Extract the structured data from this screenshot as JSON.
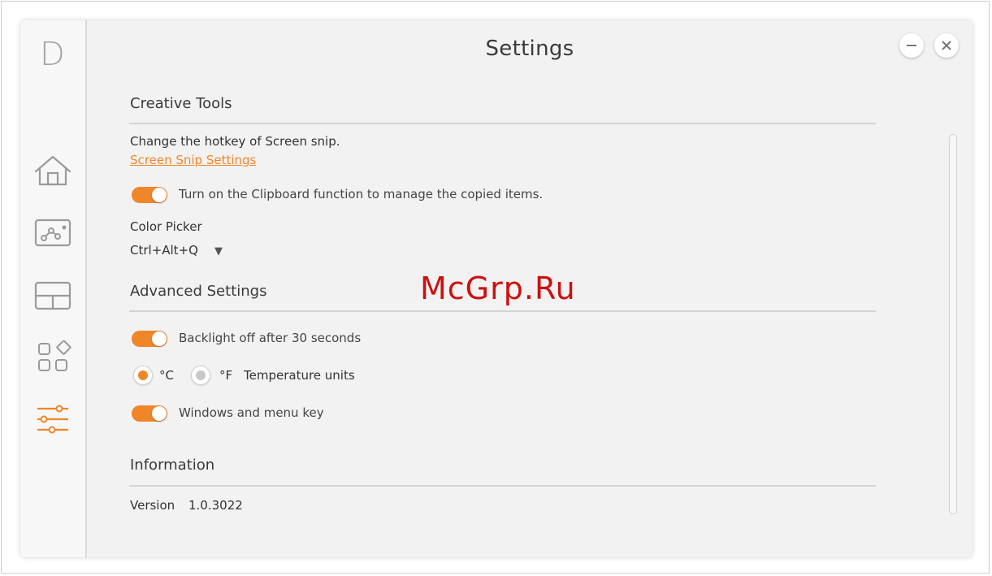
{
  "window": {
    "title": "Settings",
    "logo_letter": "D"
  },
  "sidebar": {
    "items": [
      {
        "name": "home-icon",
        "active": false
      },
      {
        "name": "creative-tools-icon",
        "active": false
      },
      {
        "name": "layout-icon",
        "active": false
      },
      {
        "name": "apps-icon",
        "active": false
      },
      {
        "name": "settings-sliders-icon",
        "active": true
      }
    ]
  },
  "creative_tools": {
    "heading": "Creative Tools",
    "hotkey_text": "Change the hotkey of Screen snip.",
    "snip_link": "Screen Snip Settings",
    "clipboard_label": "Turn on the Clipboard function to manage the copied items.",
    "clipboard_on": true,
    "color_picker_label": "Color Picker",
    "color_picker_value": "Ctrl+Alt+Q",
    "dropdown_arrow": "▼"
  },
  "advanced": {
    "heading": "Advanced Settings",
    "backlight_label": "Backlight off after 30 seconds",
    "backlight_on": true,
    "celsius_label": "°C",
    "fahrenheit_label": "°F",
    "celsius_selected": true,
    "temperature_label": "Temperature units",
    "windows_key_label": "Windows and menu key",
    "windows_key_on": true
  },
  "information": {
    "heading": "Information",
    "version_label": "Version",
    "version_value": "1.0.3022"
  },
  "watermark": "McGrp.Ru",
  "colors": {
    "accent": "#f0862a",
    "icon_gray": "#9a9a9a",
    "background": "#f2f2f2"
  }
}
